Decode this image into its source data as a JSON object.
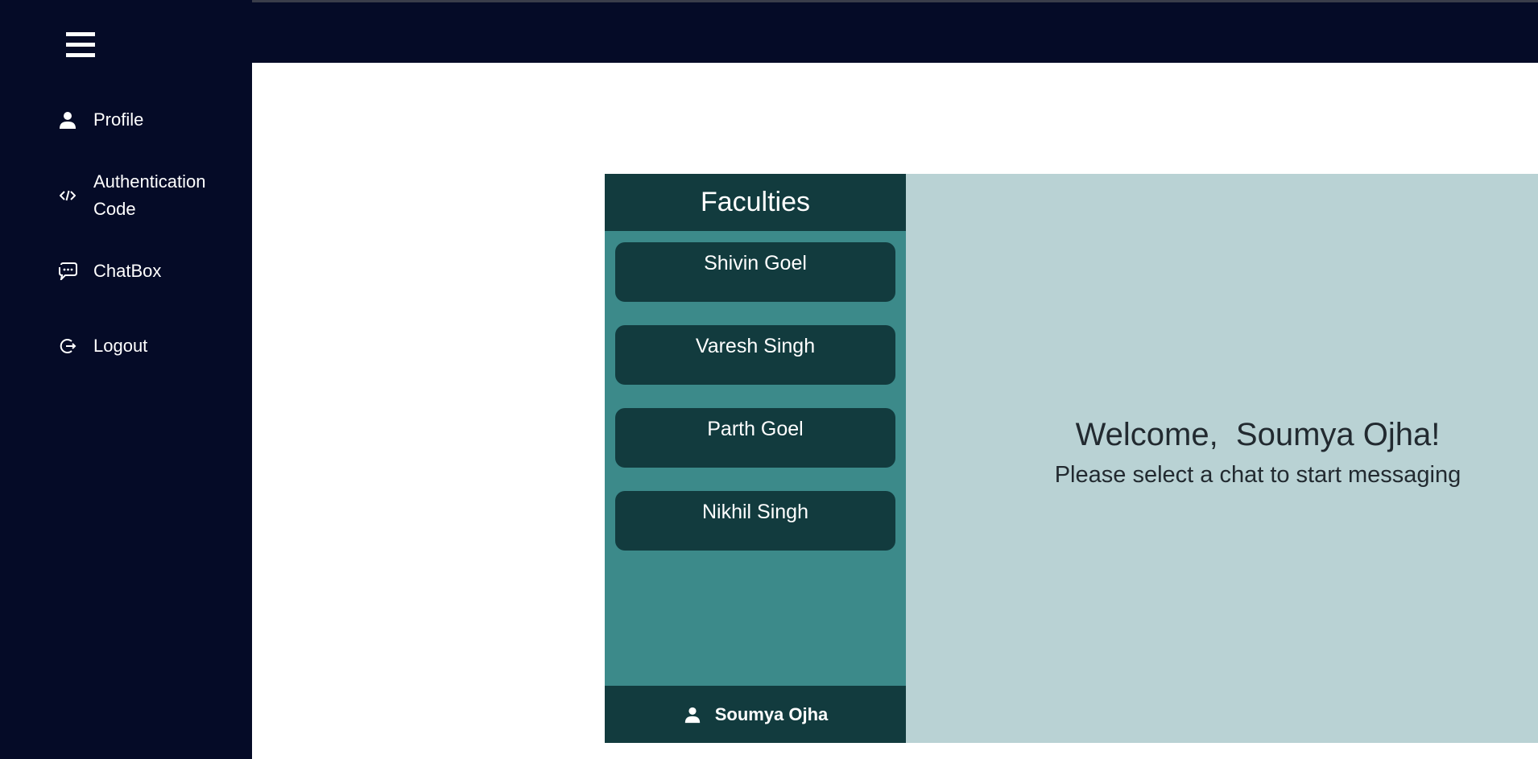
{
  "sidebar": {
    "menu_icon": "hamburger-icon",
    "items": [
      {
        "label": "Profile",
        "icon": "user-icon"
      },
      {
        "label": "Authentication Code",
        "icon": "code-icon"
      },
      {
        "label": "ChatBox",
        "icon": "chat-bubble-icon"
      },
      {
        "label": "Logout",
        "icon": "logout-icon"
      }
    ]
  },
  "faculties": {
    "title": "Faculties",
    "list": [
      "Shivin Goel",
      "Varesh Singh",
      "Parth Goel",
      "Nikhil Singh"
    ],
    "current_user": "Soumya Ojha"
  },
  "chat": {
    "welcome": "Welcome,  Soumya Ojha!",
    "hint": "Please select a chat to start messaging"
  },
  "colors": {
    "sidebar_bg": "#050b27",
    "panel_dark": "#123b3e",
    "panel_teal": "#3c8a8a",
    "chat_bg": "#b9d2d4"
  }
}
